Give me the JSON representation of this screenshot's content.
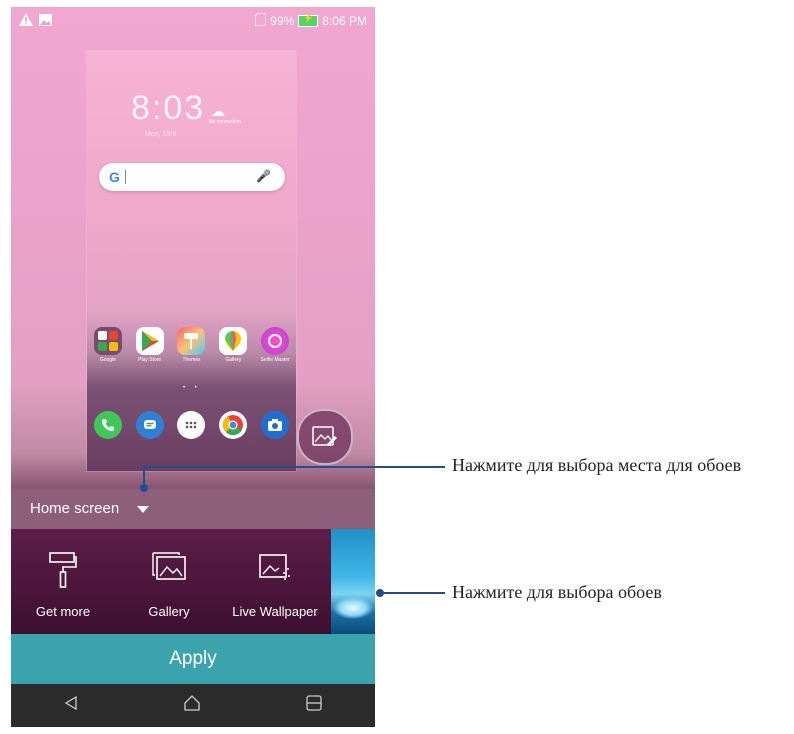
{
  "status_bar": {
    "battery_percent": "99%",
    "time": "8:06 PM"
  },
  "preview": {
    "clock": "8:03",
    "date": "Mon, 15/9",
    "weather_text": "No connection",
    "search_g": "G",
    "apps": [
      {
        "label": "Google",
        "icon": "google-folder-icon"
      },
      {
        "label": "Play Store",
        "icon": "play-store-icon"
      },
      {
        "label": "Themes",
        "icon": "themes-icon"
      },
      {
        "label": "Gallery",
        "icon": "gallery-app-icon"
      },
      {
        "label": "Selfie Master",
        "icon": "selfie-master-icon"
      }
    ],
    "page_dots": "• •"
  },
  "location_selector": {
    "label": "Home screen"
  },
  "wallpaper_options": [
    {
      "label": "Get more",
      "icon": "paint-roller-icon"
    },
    {
      "label": "Gallery",
      "icon": "gallery-icon"
    },
    {
      "label": "Live Wallpaper",
      "icon": "live-wallpaper-icon"
    }
  ],
  "apply_button": {
    "label": "Apply"
  },
  "callouts": {
    "location": "Нажмите для выбора места для обоев",
    "wallpaper": "Нажмите для выбора обоев"
  },
  "colors": {
    "apply": "#3aa3ac",
    "callout_line": "#1f4f8f",
    "nav_bar": "#2b2b2b"
  }
}
